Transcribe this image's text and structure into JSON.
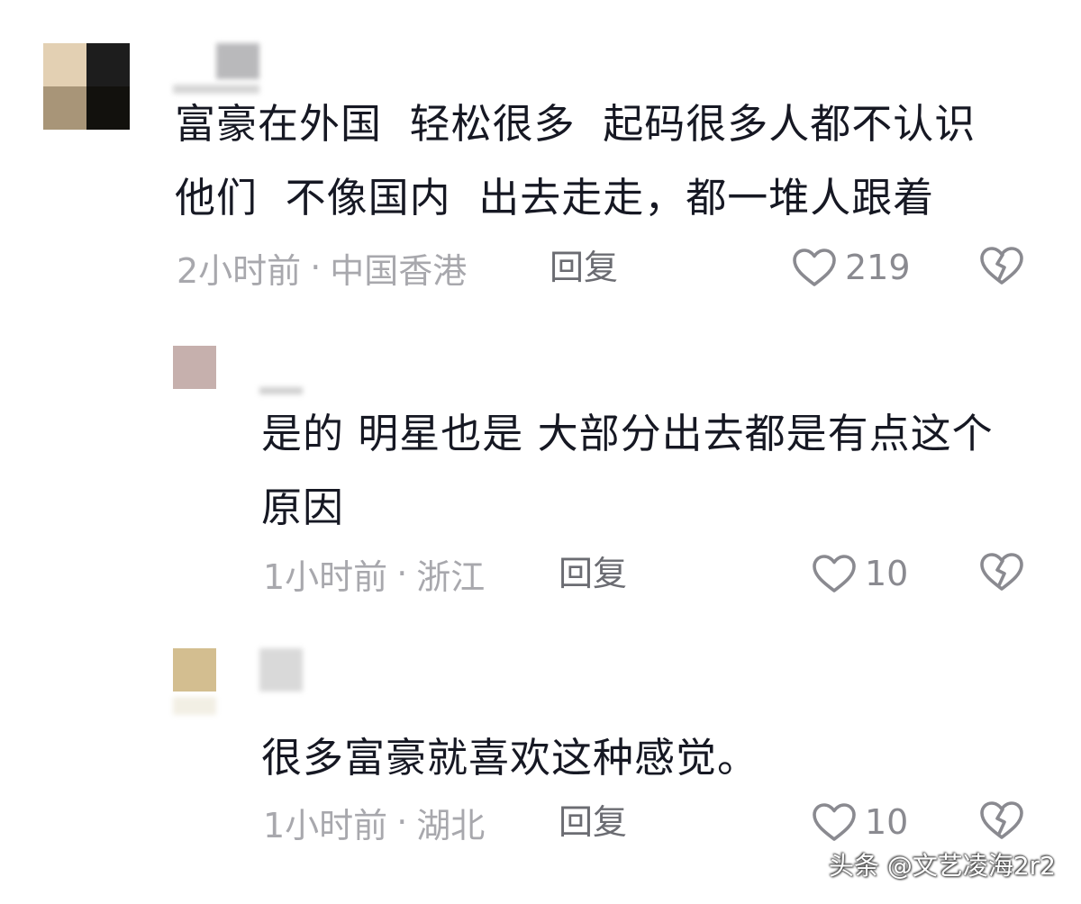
{
  "comments": [
    {
      "text_line1": "富豪在外国  轻松很多  起码很多人都不认识",
      "text_line2": "他们  不像国内  出去走走，都一堆人跟着",
      "time": "2小时前",
      "location": "中国香港",
      "reply_label": "回复",
      "like_count": "219"
    },
    {
      "text_line1": "是的 明星也是 大部分出去都是有点这个",
      "text_line2": "原因",
      "time": "1小时前",
      "location": "浙江",
      "reply_label": "回复",
      "like_count": "10"
    },
    {
      "text_line1": "很多富豪就喜欢这种感觉。",
      "time": "1小时前",
      "location": "湖北",
      "reply_label": "回复",
      "like_count": "10"
    }
  ],
  "separator": "·",
  "watermark": "头条 @文艺凌海2r2",
  "colors": {
    "text": "#161823",
    "meta": "#a8a8ad",
    "reply": "#6b6c72",
    "icon": "#8a8a90"
  },
  "icons": {
    "like": "heart-outline-icon",
    "dislike": "broken-heart-icon"
  }
}
